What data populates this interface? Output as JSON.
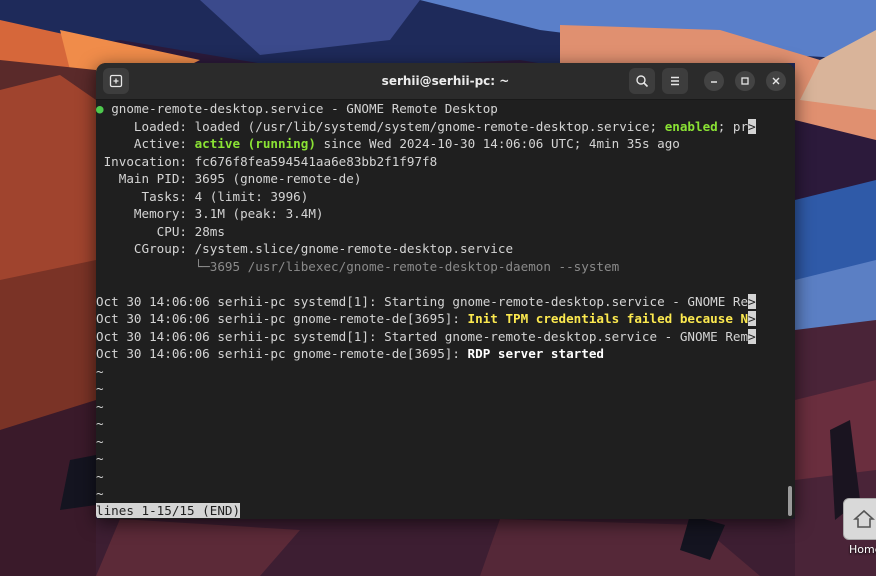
{
  "window": {
    "title": "serhii@serhii-pc: ~"
  },
  "desktop": {
    "home_label": "Home"
  },
  "unit": {
    "header": "gnome-remote-desktop.service - GNOME Remote Desktop",
    "loaded_label": "Loaded:",
    "loaded_pre": "loaded (/usr/lib/systemd/system/gnome-remote-desktop.service; ",
    "loaded_enabled": "enabled",
    "loaded_post": "; pr",
    "active_label": "Active:",
    "active_state": "active (running)",
    "active_since": " since Wed 2024-10-30 14:06:06 UTC; 4min 35s ago",
    "invocation_label": "Invocation:",
    "invocation": "fc676f8fea594541aa6e83bb2f1f97f8",
    "pid_label": "Main PID:",
    "pid": "3695 (gnome-remote-de)",
    "tasks_label": "Tasks:",
    "tasks": "4 (limit: 3996)",
    "memory_label": "Memory:",
    "memory": "3.1M (peak: 3.4M)",
    "cpu_label": "CPU:",
    "cpu": "28ms",
    "cgroup_label": "CGroup:",
    "cgroup": "/system.slice/gnome-remote-desktop.service",
    "cgroup_child": "└─3695 /usr/libexec/gnome-remote-desktop-daemon --system"
  },
  "log": [
    {
      "prefix": "Oct 30 14:06:06 serhii-pc systemd[1]: ",
      "msg": "Starting gnome-remote-desktop.service - GNOME Re"
    },
    {
      "prefix": "Oct 30 14:06:06 serhii-pc gnome-remote-de[3695]: ",
      "msg": "Init TPM credentials failed because N"
    },
    {
      "prefix": "Oct 30 14:06:06 serhii-pc systemd[1]: ",
      "msg": "Started gnome-remote-desktop.service - GNOME Rem"
    },
    {
      "prefix": "Oct 30 14:06:06 serhii-pc gnome-remote-de[3695]: ",
      "msg": "RDP server started"
    }
  ],
  "trunc_marker": ">",
  "tilde": "~",
  "pager_status": "lines 1-15/15 (END)",
  "colors": {
    "green": "#8ae234",
    "yellow": "#fce94f",
    "terminal_bg": "#1f1f1f"
  },
  "icons": [
    "new-tab-icon",
    "search-icon",
    "menu-icon",
    "minimize-icon",
    "maximize-icon",
    "close-icon",
    "home-folder-icon"
  ]
}
